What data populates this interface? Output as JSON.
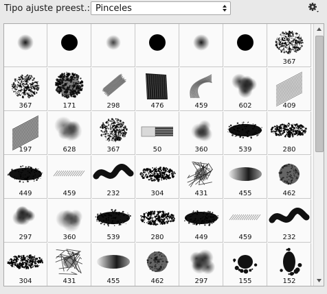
{
  "header": {
    "preset_type_label": "Tipo ajuste preest.:",
    "preset_type_value": "Pinceles"
  },
  "icons": {
    "settings": "gear-icon",
    "dropdown": "updown-arrows-icon",
    "scroll_up": "arrow-up-icon",
    "scroll_down": "arrow-down-icon"
  },
  "brushes": [
    {
      "num": "",
      "kind": "soft"
    },
    {
      "num": "",
      "kind": "hard"
    },
    {
      "num": "",
      "kind": "soft-small"
    },
    {
      "num": "",
      "kind": "hard"
    },
    {
      "num": "",
      "kind": "soft"
    },
    {
      "num": "",
      "kind": "hard"
    },
    {
      "num": "367",
      "kind": "spray"
    },
    {
      "num": "367",
      "kind": "spray"
    },
    {
      "num": "171",
      "kind": "rough"
    },
    {
      "num": "298",
      "kind": "stroke-diag"
    },
    {
      "num": "476",
      "kind": "block"
    },
    {
      "num": "459",
      "kind": "waves"
    },
    {
      "num": "602",
      "kind": "cloud"
    },
    {
      "num": "409",
      "kind": "hatch"
    },
    {
      "num": "197",
      "kind": "hatch-dark"
    },
    {
      "num": "628",
      "kind": "cloud-light"
    },
    {
      "num": "367",
      "kind": "spray"
    },
    {
      "num": "50",
      "kind": "flat-brush"
    },
    {
      "num": "360",
      "kind": "cloud-light"
    },
    {
      "num": "539",
      "kind": "horizontal-blob"
    },
    {
      "num": "280",
      "kind": "speckle-band"
    },
    {
      "num": "449",
      "kind": "horizontal-blob"
    },
    {
      "num": "459",
      "kind": "thin-band"
    },
    {
      "num": "232",
      "kind": "wavy-band"
    },
    {
      "num": "304",
      "kind": "speckle-band"
    },
    {
      "num": "431",
      "kind": "scribble"
    },
    {
      "num": "455",
      "kind": "smudge"
    },
    {
      "num": "462",
      "kind": "round-texture"
    },
    {
      "num": "297",
      "kind": "cloud"
    },
    {
      "num": "360",
      "kind": "cloud-light"
    },
    {
      "num": "539",
      "kind": "horizontal-blob"
    },
    {
      "num": "280",
      "kind": "speckle-band"
    },
    {
      "num": "449",
      "kind": "horizontal-blob"
    },
    {
      "num": "459",
      "kind": "thin-band"
    },
    {
      "num": "232",
      "kind": "wavy-band"
    },
    {
      "num": "304",
      "kind": "speckle-band"
    },
    {
      "num": "431",
      "kind": "scribble"
    },
    {
      "num": "455",
      "kind": "smudge"
    },
    {
      "num": "462",
      "kind": "round-texture"
    },
    {
      "num": "297",
      "kind": "cloud"
    },
    {
      "num": "155",
      "kind": "splat"
    },
    {
      "num": "152",
      "kind": "splat-tall"
    }
  ]
}
